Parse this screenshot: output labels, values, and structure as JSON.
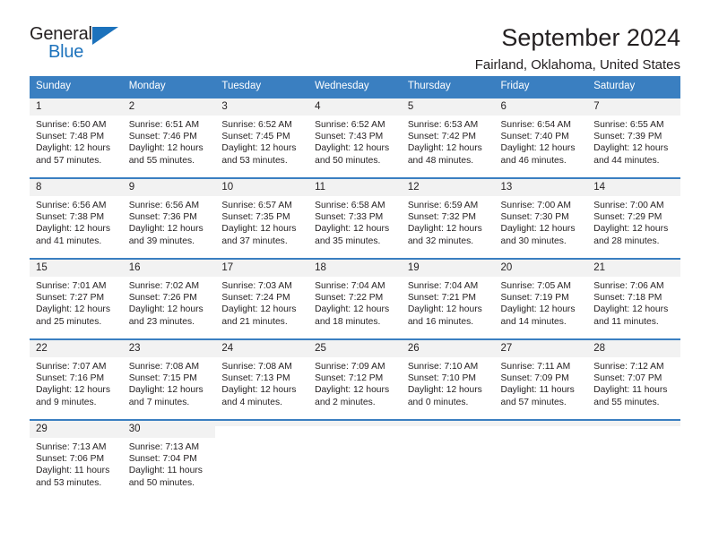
{
  "brand": {
    "name_dark": "General",
    "name_blue": "Blue",
    "accent_color": "#1c72bc"
  },
  "header": {
    "title": "September 2024",
    "subtitle": "Fairland, Oklahoma, United States"
  },
  "theme": {
    "header_blue": "#3a7fc1",
    "daynum_band": "#f2f2f2",
    "text": "#231f20"
  },
  "weekdays": [
    "Sunday",
    "Monday",
    "Tuesday",
    "Wednesday",
    "Thursday",
    "Friday",
    "Saturday"
  ],
  "labels": {
    "sunrise_prefix": "Sunrise:",
    "sunset_prefix": "Sunset:",
    "daylight_prefix": "Daylight:"
  },
  "weeks": [
    [
      {
        "day": "1",
        "sunrise": "Sunrise: 6:50 AM",
        "sunset": "Sunset: 7:48 PM",
        "daylight1": "Daylight: 12 hours",
        "daylight2": "and 57 minutes."
      },
      {
        "day": "2",
        "sunrise": "Sunrise: 6:51 AM",
        "sunset": "Sunset: 7:46 PM",
        "daylight1": "Daylight: 12 hours",
        "daylight2": "and 55 minutes."
      },
      {
        "day": "3",
        "sunrise": "Sunrise: 6:52 AM",
        "sunset": "Sunset: 7:45 PM",
        "daylight1": "Daylight: 12 hours",
        "daylight2": "and 53 minutes."
      },
      {
        "day": "4",
        "sunrise": "Sunrise: 6:52 AM",
        "sunset": "Sunset: 7:43 PM",
        "daylight1": "Daylight: 12 hours",
        "daylight2": "and 50 minutes."
      },
      {
        "day": "5",
        "sunrise": "Sunrise: 6:53 AM",
        "sunset": "Sunset: 7:42 PM",
        "daylight1": "Daylight: 12 hours",
        "daylight2": "and 48 minutes."
      },
      {
        "day": "6",
        "sunrise": "Sunrise: 6:54 AM",
        "sunset": "Sunset: 7:40 PM",
        "daylight1": "Daylight: 12 hours",
        "daylight2": "and 46 minutes."
      },
      {
        "day": "7",
        "sunrise": "Sunrise: 6:55 AM",
        "sunset": "Sunset: 7:39 PM",
        "daylight1": "Daylight: 12 hours",
        "daylight2": "and 44 minutes."
      }
    ],
    [
      {
        "day": "8",
        "sunrise": "Sunrise: 6:56 AM",
        "sunset": "Sunset: 7:38 PM",
        "daylight1": "Daylight: 12 hours",
        "daylight2": "and 41 minutes."
      },
      {
        "day": "9",
        "sunrise": "Sunrise: 6:56 AM",
        "sunset": "Sunset: 7:36 PM",
        "daylight1": "Daylight: 12 hours",
        "daylight2": "and 39 minutes."
      },
      {
        "day": "10",
        "sunrise": "Sunrise: 6:57 AM",
        "sunset": "Sunset: 7:35 PM",
        "daylight1": "Daylight: 12 hours",
        "daylight2": "and 37 minutes."
      },
      {
        "day": "11",
        "sunrise": "Sunrise: 6:58 AM",
        "sunset": "Sunset: 7:33 PM",
        "daylight1": "Daylight: 12 hours",
        "daylight2": "and 35 minutes."
      },
      {
        "day": "12",
        "sunrise": "Sunrise: 6:59 AM",
        "sunset": "Sunset: 7:32 PM",
        "daylight1": "Daylight: 12 hours",
        "daylight2": "and 32 minutes."
      },
      {
        "day": "13",
        "sunrise": "Sunrise: 7:00 AM",
        "sunset": "Sunset: 7:30 PM",
        "daylight1": "Daylight: 12 hours",
        "daylight2": "and 30 minutes."
      },
      {
        "day": "14",
        "sunrise": "Sunrise: 7:00 AM",
        "sunset": "Sunset: 7:29 PM",
        "daylight1": "Daylight: 12 hours",
        "daylight2": "and 28 minutes."
      }
    ],
    [
      {
        "day": "15",
        "sunrise": "Sunrise: 7:01 AM",
        "sunset": "Sunset: 7:27 PM",
        "daylight1": "Daylight: 12 hours",
        "daylight2": "and 25 minutes."
      },
      {
        "day": "16",
        "sunrise": "Sunrise: 7:02 AM",
        "sunset": "Sunset: 7:26 PM",
        "daylight1": "Daylight: 12 hours",
        "daylight2": "and 23 minutes."
      },
      {
        "day": "17",
        "sunrise": "Sunrise: 7:03 AM",
        "sunset": "Sunset: 7:24 PM",
        "daylight1": "Daylight: 12 hours",
        "daylight2": "and 21 minutes."
      },
      {
        "day": "18",
        "sunrise": "Sunrise: 7:04 AM",
        "sunset": "Sunset: 7:22 PM",
        "daylight1": "Daylight: 12 hours",
        "daylight2": "and 18 minutes."
      },
      {
        "day": "19",
        "sunrise": "Sunrise: 7:04 AM",
        "sunset": "Sunset: 7:21 PM",
        "daylight1": "Daylight: 12 hours",
        "daylight2": "and 16 minutes."
      },
      {
        "day": "20",
        "sunrise": "Sunrise: 7:05 AM",
        "sunset": "Sunset: 7:19 PM",
        "daylight1": "Daylight: 12 hours",
        "daylight2": "and 14 minutes."
      },
      {
        "day": "21",
        "sunrise": "Sunrise: 7:06 AM",
        "sunset": "Sunset: 7:18 PM",
        "daylight1": "Daylight: 12 hours",
        "daylight2": "and 11 minutes."
      }
    ],
    [
      {
        "day": "22",
        "sunrise": "Sunrise: 7:07 AM",
        "sunset": "Sunset: 7:16 PM",
        "daylight1": "Daylight: 12 hours",
        "daylight2": "and 9 minutes."
      },
      {
        "day": "23",
        "sunrise": "Sunrise: 7:08 AM",
        "sunset": "Sunset: 7:15 PM",
        "daylight1": "Daylight: 12 hours",
        "daylight2": "and 7 minutes."
      },
      {
        "day": "24",
        "sunrise": "Sunrise: 7:08 AM",
        "sunset": "Sunset: 7:13 PM",
        "daylight1": "Daylight: 12 hours",
        "daylight2": "and 4 minutes."
      },
      {
        "day": "25",
        "sunrise": "Sunrise: 7:09 AM",
        "sunset": "Sunset: 7:12 PM",
        "daylight1": "Daylight: 12 hours",
        "daylight2": "and 2 minutes."
      },
      {
        "day": "26",
        "sunrise": "Sunrise: 7:10 AM",
        "sunset": "Sunset: 7:10 PM",
        "daylight1": "Daylight: 12 hours",
        "daylight2": "and 0 minutes."
      },
      {
        "day": "27",
        "sunrise": "Sunrise: 7:11 AM",
        "sunset": "Sunset: 7:09 PM",
        "daylight1": "Daylight: 11 hours",
        "daylight2": "and 57 minutes."
      },
      {
        "day": "28",
        "sunrise": "Sunrise: 7:12 AM",
        "sunset": "Sunset: 7:07 PM",
        "daylight1": "Daylight: 11 hours",
        "daylight2": "and 55 minutes."
      }
    ],
    [
      {
        "day": "29",
        "sunrise": "Sunrise: 7:13 AM",
        "sunset": "Sunset: 7:06 PM",
        "daylight1": "Daylight: 11 hours",
        "daylight2": "and 53 minutes."
      },
      {
        "day": "30",
        "sunrise": "Sunrise: 7:13 AM",
        "sunset": "Sunset: 7:04 PM",
        "daylight1": "Daylight: 11 hours",
        "daylight2": "and 50 minutes."
      },
      {
        "day": "",
        "sunrise": "",
        "sunset": "",
        "daylight1": "",
        "daylight2": ""
      },
      {
        "day": "",
        "sunrise": "",
        "sunset": "",
        "daylight1": "",
        "daylight2": ""
      },
      {
        "day": "",
        "sunrise": "",
        "sunset": "",
        "daylight1": "",
        "daylight2": ""
      },
      {
        "day": "",
        "sunrise": "",
        "sunset": "",
        "daylight1": "",
        "daylight2": ""
      },
      {
        "day": "",
        "sunrise": "",
        "sunset": "",
        "daylight1": "",
        "daylight2": ""
      }
    ]
  ]
}
